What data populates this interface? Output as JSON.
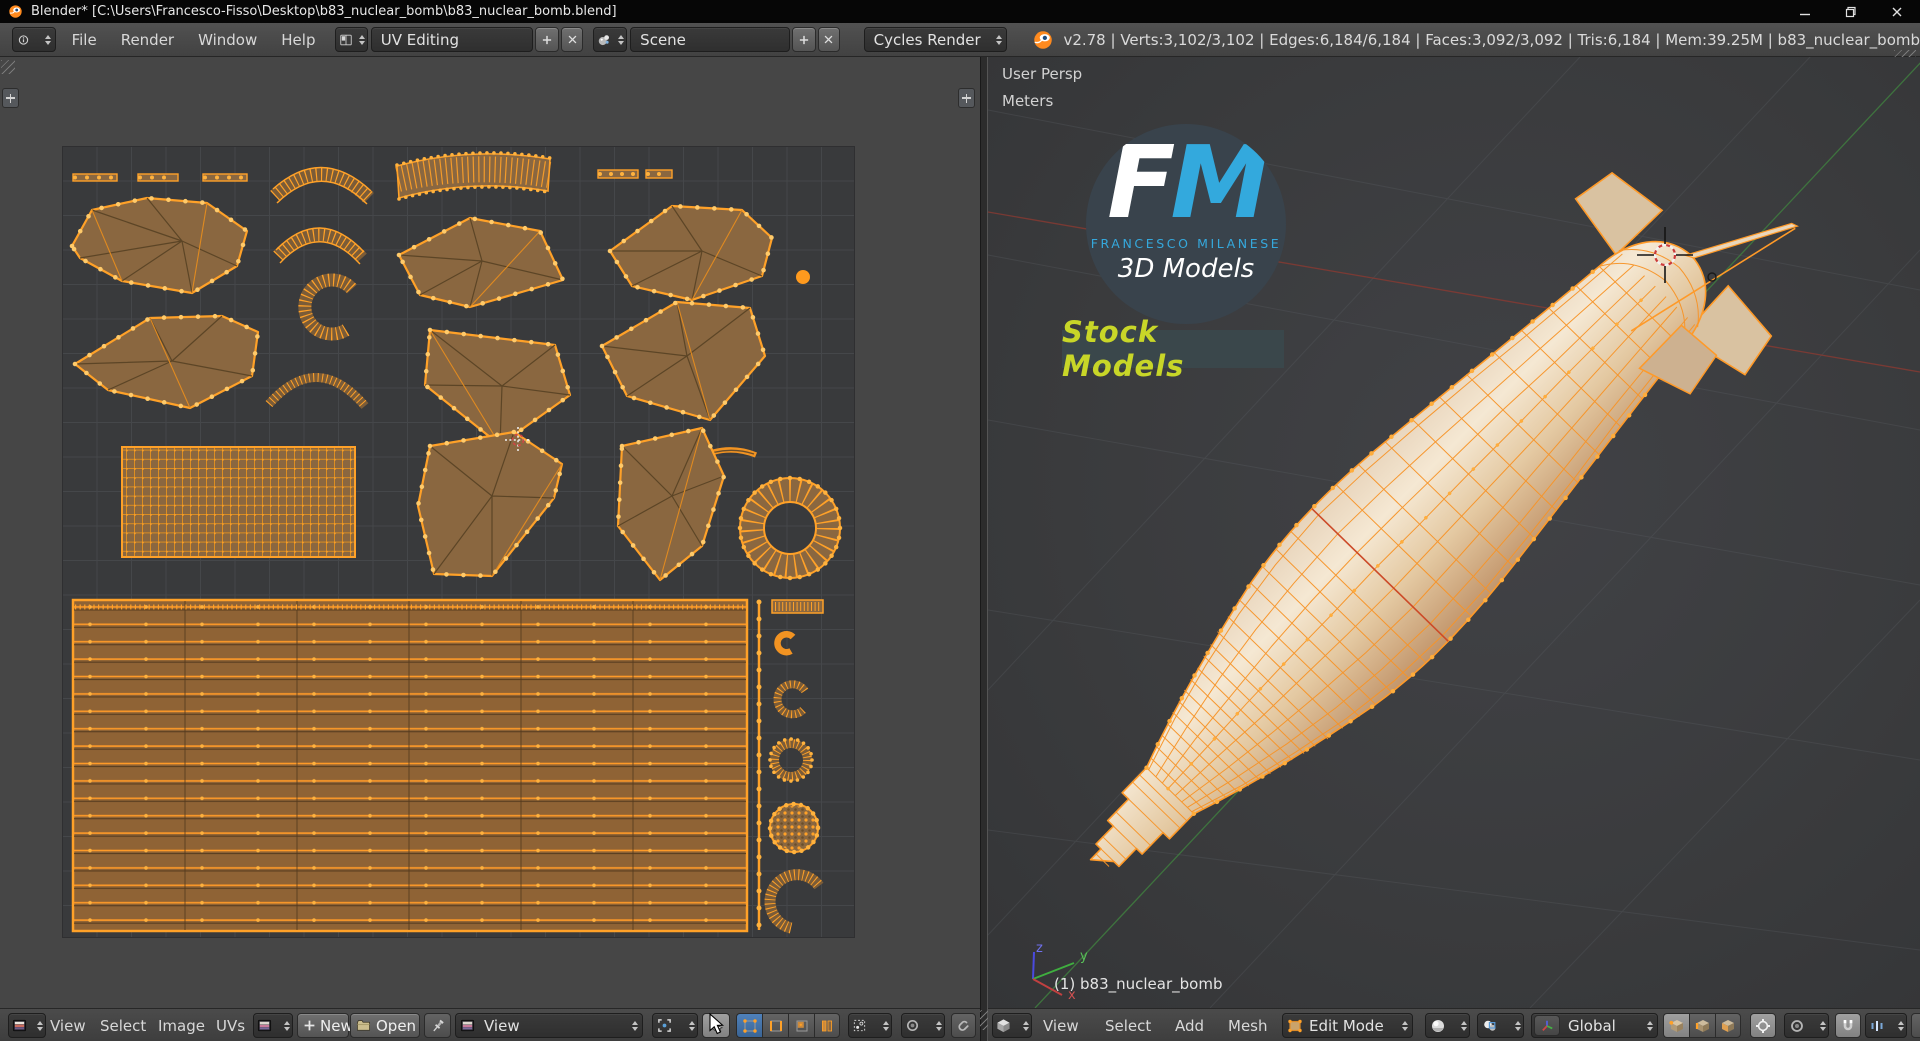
{
  "window": {
    "title": "Blender* [C:\\Users\\Francesco-Fisso\\Desktop\\b83_nuclear_bomb\\b83_nuclear_bomb.blend]"
  },
  "topbar": {
    "menus": [
      "File",
      "Render",
      "Window",
      "Help"
    ],
    "layout_name": "UV Editing",
    "scene_name": "Scene",
    "engine": "Cycles Render",
    "stats": "v2.78 | Verts:3,102/3,102 | Edges:6,184/6,184 | Faces:3,092/3,092 | Tris:6,184 | Mem:39.25M | b83_nuclear_bomb"
  },
  "uv_editor": {
    "menus": [
      "View",
      "Select",
      "Image",
      "UVs"
    ],
    "new_button": "New",
    "open_button": "Open",
    "view_dropdown": "View"
  },
  "viewport": {
    "perspective_label": "User Persp",
    "units_label": "Meters",
    "object_info": "(1) b83_nuclear_bomb",
    "axis": {
      "x": "x",
      "y": "y",
      "z": "z"
    },
    "menus": [
      "View",
      "Select",
      "Add",
      "Mesh"
    ],
    "mode": "Edit Mode",
    "orientation": "Global"
  },
  "watermark": {
    "monogram_f": "F",
    "monogram_m": "M",
    "name": "FRANCESCO MILANESE",
    "tagline": "3D Models",
    "banner": "Stock Models"
  },
  "colors": {
    "accent_orange": "#ff9a1e",
    "selection_blue": "#3a6ea5",
    "logo_blue": "#33a9dd",
    "banner_yellow": "#c8d628",
    "axis_x_red": "#a04038",
    "axis_y_green": "#3f7a3f",
    "axis_z_blue": "#5050e0"
  }
}
